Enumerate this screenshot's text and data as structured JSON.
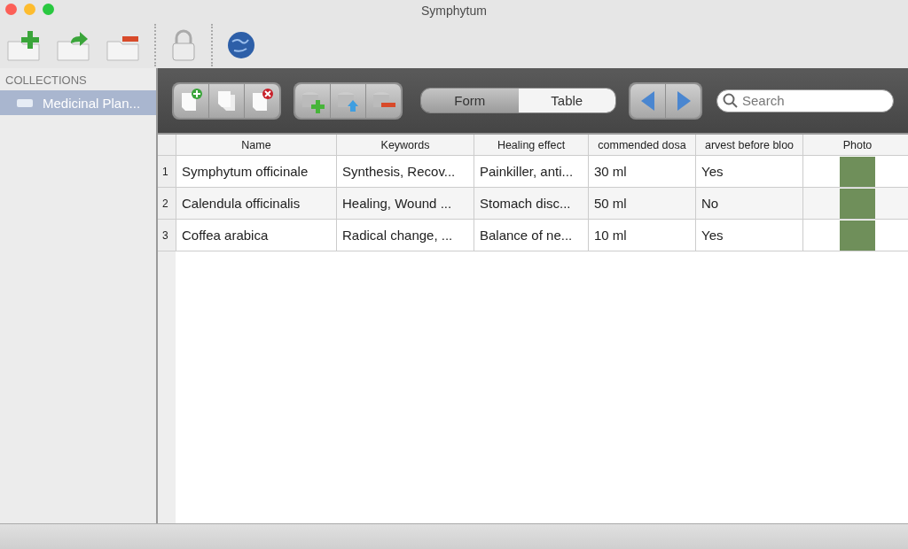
{
  "window": {
    "title": "Symphytum"
  },
  "sidebar": {
    "heading": "COLLECTIONS",
    "items": [
      {
        "label": "Medicinal Plan...",
        "selected": true
      }
    ]
  },
  "view_switch": [
    {
      "label": "Form",
      "selected": false
    },
    {
      "label": "Table",
      "selected": true
    }
  ],
  "search": {
    "placeholder": "Search"
  },
  "table": {
    "columns": [
      "Name",
      "Keywords",
      "Healing effect",
      "commended dosa",
      "arvest before bloo",
      "Photo"
    ],
    "rows": [
      {
        "number": "1",
        "cells": [
          "Symphytum officinale",
          "Synthesis, Recov...",
          "Painkiller, anti...",
          "30 ml",
          "Yes"
        ]
      },
      {
        "number": "2",
        "cells": [
          "Calendula officinalis",
          "Healing, Wound ...",
          "Stomach disc...",
          "50 ml",
          "No"
        ]
      },
      {
        "number": "3",
        "cells": [
          "Coffea arabica",
          "Radical change, ...",
          "Balance of ne...",
          "10 ml",
          "Yes"
        ]
      }
    ]
  }
}
